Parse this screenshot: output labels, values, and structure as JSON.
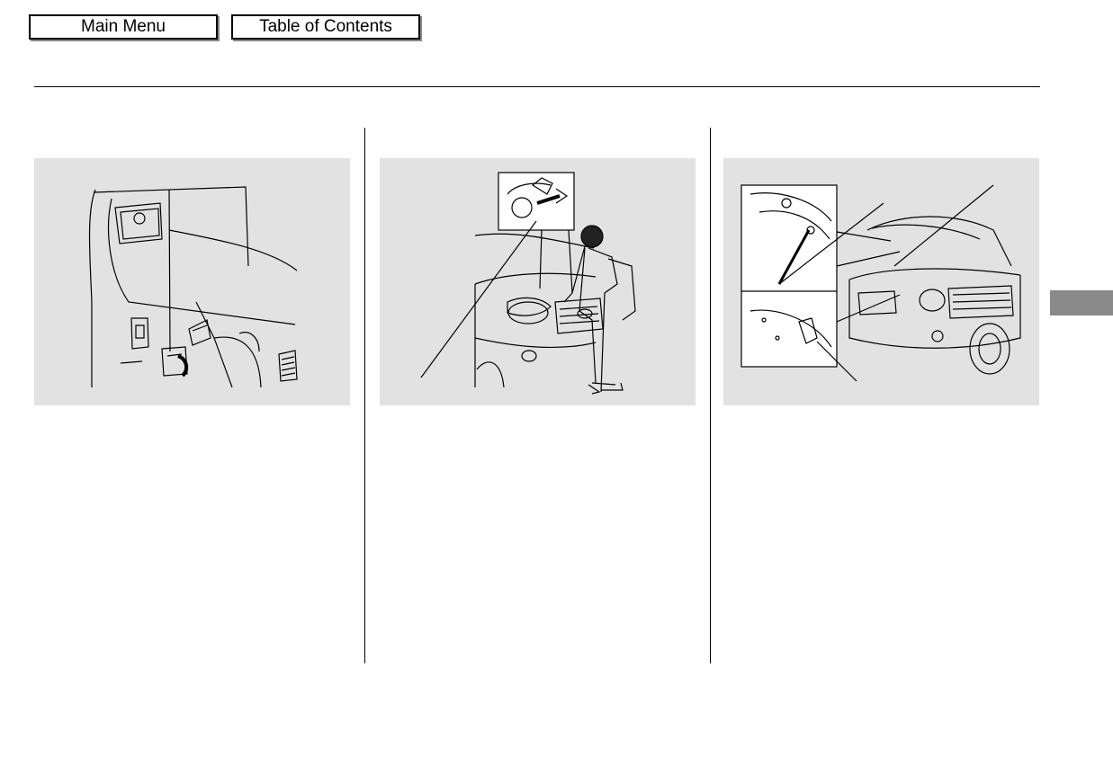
{
  "nav": {
    "main_menu_label": "Main Menu",
    "table_of_contents_label": "Table of Contents"
  },
  "figures": [
    {
      "id": "hood-release-handle"
    },
    {
      "id": "hood-latch-lever"
    },
    {
      "id": "hood-support-rod"
    }
  ],
  "colors": {
    "panel_background": "#e2e2e2",
    "section_tab": "#8a8a8a",
    "line_art": "#000000"
  }
}
